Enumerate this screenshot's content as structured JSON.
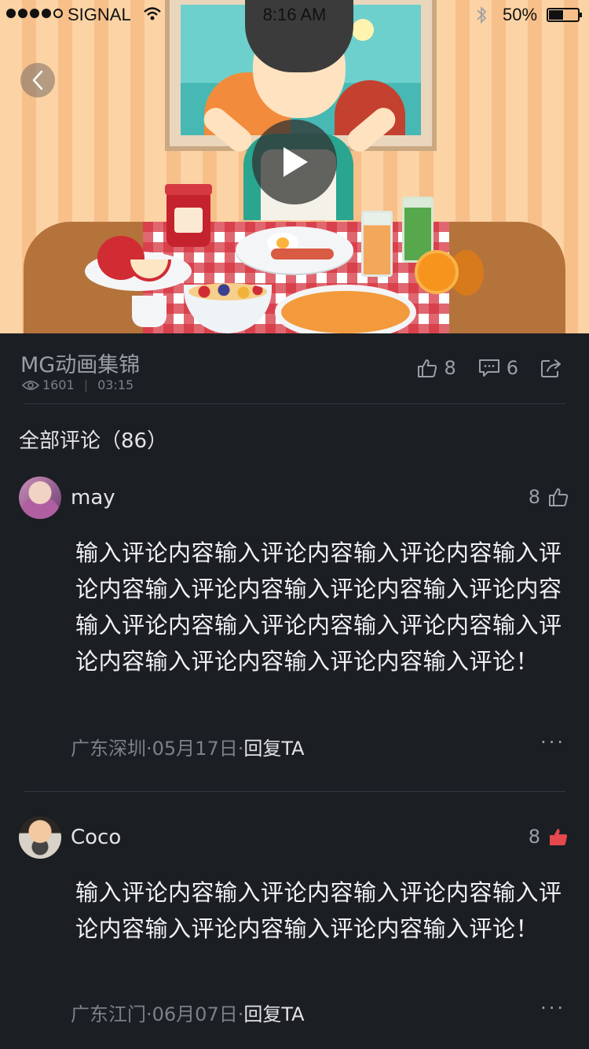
{
  "status_bar": {
    "carrier": "SIGNAL",
    "time": "8:16 AM",
    "battery": "50%",
    "battery_level": 0.5,
    "signal_strength": 4
  },
  "video": {
    "title": "MG动画集锦",
    "views": "1601",
    "duration": "03:15",
    "likes": "8",
    "comments": "6"
  },
  "comments_section": {
    "heading": "全部评论（86）"
  },
  "comments": [
    {
      "username": "may",
      "likes": "8",
      "liked": false,
      "text": "输入评论内容输入评论内容输入评论内容输入评论内容输入评论内容输入评论内容输入评论内容输入评论内容输入评论内容输入评论内容输入评论内容输入评论内容输入评论内容输入评论！",
      "location": "广东深圳",
      "date": "05月17日",
      "reply_label": "回复TA",
      "more": "···"
    },
    {
      "username": "Coco",
      "likes": "8",
      "liked": true,
      "text": "输入评论内容输入评论内容输入评论内容输入评论内容输入评论内容输入评论内容输入评论！",
      "location": "广东江门",
      "date": "06月07日",
      "reply_label": "回复TA",
      "more": "···"
    }
  ],
  "colors": {
    "background": "#1b1e23",
    "liked": "#e5484d",
    "muted": "#9a9ea6"
  }
}
